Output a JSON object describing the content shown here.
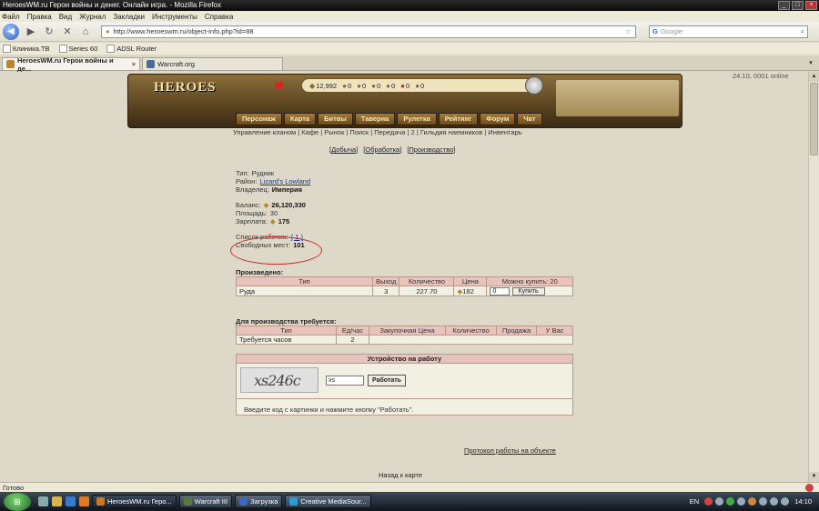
{
  "window": {
    "title": "HeroesWM.ru Герои войны и денег. Онлайн игра. - Mozilla Firefox"
  },
  "menu": [
    "Файл",
    "Правка",
    "Вид",
    "Журнал",
    "Закладки",
    "Инструменты",
    "Справка"
  ],
  "nav": {
    "url": "http://www.heroeswm.ru/object-info.php?id=88",
    "search_placeholder": "Google"
  },
  "bookmarks": [
    "Клиника.ТВ",
    "Series 60",
    "ADSL Router"
  ],
  "tabs": [
    {
      "label": "HeroesWM.ru Герои войны и де...",
      "active": true
    },
    {
      "label": "Warcraft.org",
      "active": false
    }
  ],
  "clock_top": "24:10, 0001 online",
  "game": {
    "logo": "HEROES",
    "resources": [
      {
        "icon": "gold-icon",
        "value": "12,992"
      },
      {
        "icon": "wood-icon",
        "value": "0"
      },
      {
        "icon": "ore-icon",
        "value": "0"
      },
      {
        "icon": "mercury-icon",
        "value": "0"
      },
      {
        "icon": "sulfur-icon",
        "value": "0"
      },
      {
        "icon": "crystal-icon",
        "value": "0"
      },
      {
        "icon": "gem-icon",
        "value": "0"
      }
    ],
    "menu": [
      "Персонаж",
      "Карта",
      "Битвы",
      "Таверна",
      "Рулетка",
      "Рейтинг",
      "Форум",
      "Чат"
    ],
    "sublinks": "Управление кланом | Кафе | Рынок | Поиск | Передача | 2 | Гильдия наемников | Инвентарь"
  },
  "filters": [
    "Добыча",
    "Обработка",
    "Производство"
  ],
  "object": {
    "type_label": "Тип:",
    "type_value": "Рудник",
    "district_label": "Район:",
    "district_value": "Lizard's Lowland",
    "owner_label": "Владелец:",
    "owner_value": "Империя",
    "balance_label": "Баланс:",
    "balance_value": "26,120,330",
    "area_label": "Площадь:",
    "area_value": "30",
    "salary_label": "Зарплата:",
    "salary_value": "175",
    "workers_label": "Список рабочих:",
    "workers_value": "( 1 )",
    "free_label": "Свободных мест:",
    "free_value": "101"
  },
  "produced": {
    "title": "Произведено:",
    "headers": [
      "Тип",
      "Выход",
      "Количество",
      "Цена",
      "Можно купить: 20"
    ],
    "row": {
      "type": "Руда",
      "output": "3",
      "quantity": "227.70",
      "price": "182",
      "qty_input": "0",
      "buy_label": "Купить"
    }
  },
  "required": {
    "title": "Для производства требуется:",
    "headers": [
      "Тип",
      "Ед/час",
      "Закупочная Цена",
      "Количество",
      "Продажа",
      "У Вас"
    ],
    "row": {
      "type": "Требуется часов",
      "per_hour": "2"
    }
  },
  "work": {
    "title": "Устройство на работу",
    "captcha_text": "xs246c",
    "input_value": "xs",
    "button_label": "Работать",
    "hint": "Введите код с картинки и нажмите кнопку \"Работать\"."
  },
  "protocol_link": "Протокол работы на объекте",
  "back_link": "Назад к карте",
  "statusbar": "Готово",
  "taskbar": {
    "tasks": [
      "HeroesWM.ru Геро...",
      "Warcraft III",
      "Загрузка",
      "Creative MediaSour..."
    ],
    "lang": "EN",
    "time": "14:10"
  }
}
